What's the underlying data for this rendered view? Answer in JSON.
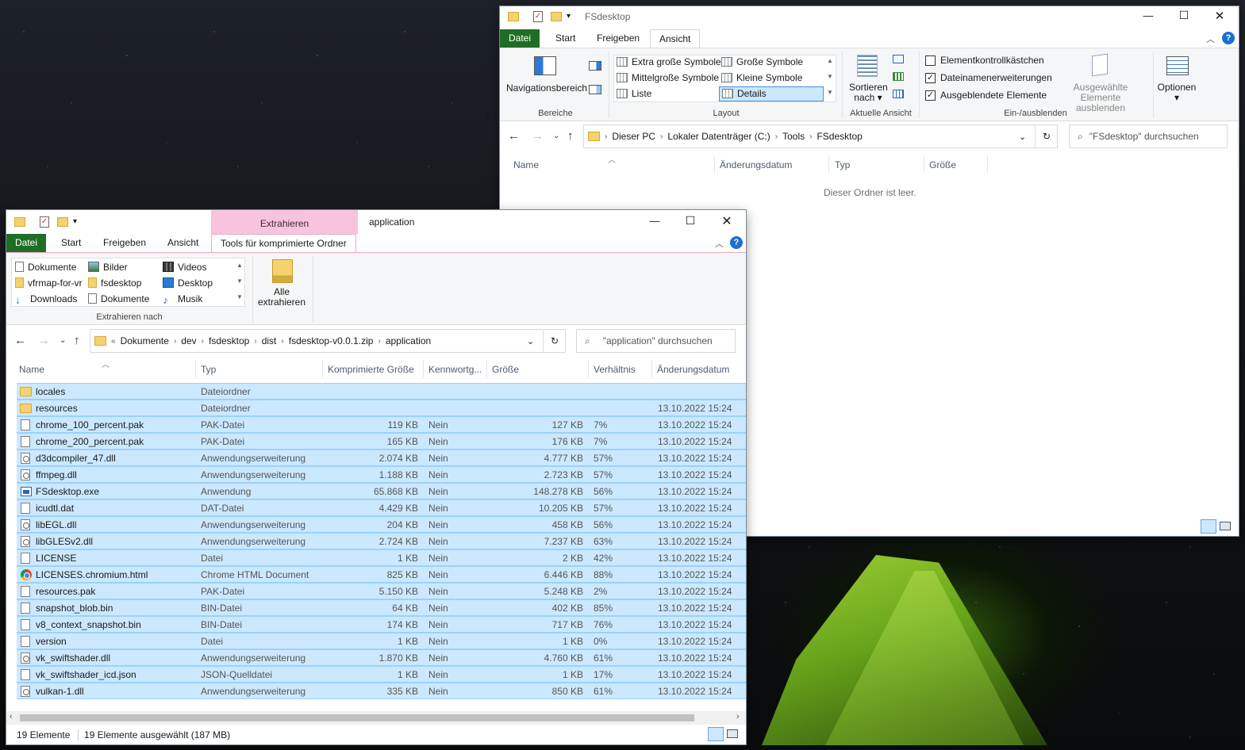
{
  "back_window": {
    "title": "FSdesktop",
    "tabs": [
      "Datei",
      "Start",
      "Freigeben",
      "Ansicht"
    ],
    "ribbon": {
      "bereiche": {
        "nav_pane": "Navigationsbereich",
        "label": "Bereiche"
      },
      "layout": {
        "items": [
          "Extra große Symbole",
          "Große Symbole",
          "Mittelgroße Symbole",
          "Kleine Symbole",
          "Liste",
          "Details"
        ],
        "selected": "Details",
        "label": "Layout"
      },
      "current_view": {
        "sort_line1": "Sortieren",
        "sort_line2": "nach",
        "label": "Aktuelle Ansicht"
      },
      "show_hide": {
        "checkboxes": [
          {
            "label": "Elementkontrollkästchen",
            "checked": false
          },
          {
            "label": "Dateinamenerweiterungen",
            "checked": true
          },
          {
            "label": "Ausgeblendete Elemente",
            "checked": true
          }
        ],
        "hide_selected_line1": "Ausgewählte",
        "hide_selected_line2": "Elemente ausblenden",
        "label": "Ein-/ausblenden"
      },
      "options": {
        "label": "Optionen"
      }
    },
    "address": [
      "Dieser PC",
      "Lokaler Datenträger (C:)",
      "Tools",
      "FSdesktop"
    ],
    "search_placeholder": "\"FSdesktop\" durchsuchen",
    "columns": [
      "Name",
      "Änderungsdatum",
      "Typ",
      "Größe"
    ],
    "empty_message": "Dieser Ordner ist leer."
  },
  "front_window": {
    "title": "application",
    "context_tab": "Extrahieren",
    "tabs": [
      "Datei",
      "Start",
      "Freigeben",
      "Ansicht",
      "Tools für komprimierte Ordner"
    ],
    "ribbon": {
      "quick_access": [
        [
          "Dokumente",
          "Bilder",
          "Videos"
        ],
        [
          "vfrmap-for-vr",
          "fsdesktop",
          "Desktop"
        ],
        [
          "Downloads",
          "Dokumente",
          "Musik"
        ]
      ],
      "extract_to_label": "Extrahieren nach",
      "extract_all_line1": "Alle",
      "extract_all_line2": "extrahieren"
    },
    "address_prefix": "«",
    "address": [
      "Dokumente",
      "dev",
      "fsdesktop",
      "dist",
      "fsdesktop-v0.0.1.zip",
      "application"
    ],
    "search_placeholder": "\"application\" durchsuchen",
    "columns": [
      "Name",
      "Typ",
      "Komprimierte Größe",
      "Kennwortg...",
      "Größe",
      "Verhältnis",
      "Änderungsdatum"
    ],
    "files": [
      {
        "icon": "folder",
        "name": "locales",
        "type": "Dateiordner",
        "compressed": "",
        "protected": "",
        "size": "",
        "ratio": "",
        "date": ""
      },
      {
        "icon": "folder",
        "name": "resources",
        "type": "Dateiordner",
        "compressed": "",
        "protected": "",
        "size": "",
        "ratio": "",
        "date": "13.10.2022 15:24"
      },
      {
        "icon": "file",
        "name": "chrome_100_percent.pak",
        "type": "PAK-Datei",
        "compressed": "119 KB",
        "protected": "Nein",
        "size": "127 KB",
        "ratio": "7%",
        "date": "13.10.2022 15:24"
      },
      {
        "icon": "file",
        "name": "chrome_200_percent.pak",
        "type": "PAK-Datei",
        "compressed": "165 KB",
        "protected": "Nein",
        "size": "176 KB",
        "ratio": "7%",
        "date": "13.10.2022 15:24"
      },
      {
        "icon": "gear",
        "name": "d3dcompiler_47.dll",
        "type": "Anwendungserweiterung",
        "compressed": "2.074 KB",
        "protected": "Nein",
        "size": "4.777 KB",
        "ratio": "57%",
        "date": "13.10.2022 15:24"
      },
      {
        "icon": "gear",
        "name": "ffmpeg.dll",
        "type": "Anwendungserweiterung",
        "compressed": "1.188 KB",
        "protected": "Nein",
        "size": "2.723 KB",
        "ratio": "57%",
        "date": "13.10.2022 15:24"
      },
      {
        "icon": "exe",
        "name": "FSdesktop.exe",
        "type": "Anwendung",
        "compressed": "65.868 KB",
        "protected": "Nein",
        "size": "148.278 KB",
        "ratio": "56%",
        "date": "13.10.2022 15:24"
      },
      {
        "icon": "file",
        "name": "icudtl.dat",
        "type": "DAT-Datei",
        "compressed": "4.429 KB",
        "protected": "Nein",
        "size": "10.205 KB",
        "ratio": "57%",
        "date": "13.10.2022 15:24"
      },
      {
        "icon": "gear",
        "name": "libEGL.dll",
        "type": "Anwendungserweiterung",
        "compressed": "204 KB",
        "protected": "Nein",
        "size": "458 KB",
        "ratio": "56%",
        "date": "13.10.2022 15:24"
      },
      {
        "icon": "gear",
        "name": "libGLESv2.dll",
        "type": "Anwendungserweiterung",
        "compressed": "2.724 KB",
        "protected": "Nein",
        "size": "7.237 KB",
        "ratio": "63%",
        "date": "13.10.2022 15:24"
      },
      {
        "icon": "file",
        "name": "LICENSE",
        "type": "Datei",
        "compressed": "1 KB",
        "protected": "Nein",
        "size": "2 KB",
        "ratio": "42%",
        "date": "13.10.2022 15:24"
      },
      {
        "icon": "chrome",
        "name": "LICENSES.chromium.html",
        "type": "Chrome HTML Document",
        "compressed": "825 KB",
        "protected": "Nein",
        "size": "6.446 KB",
        "ratio": "88%",
        "date": "13.10.2022 15:24"
      },
      {
        "icon": "file",
        "name": "resources.pak",
        "type": "PAK-Datei",
        "compressed": "5.150 KB",
        "protected": "Nein",
        "size": "5.248 KB",
        "ratio": "2%",
        "date": "13.10.2022 15:24"
      },
      {
        "icon": "file",
        "name": "snapshot_blob.bin",
        "type": "BIN-Datei",
        "compressed": "64 KB",
        "protected": "Nein",
        "size": "402 KB",
        "ratio": "85%",
        "date": "13.10.2022 15:24"
      },
      {
        "icon": "file",
        "name": "v8_context_snapshot.bin",
        "type": "BIN-Datei",
        "compressed": "174 KB",
        "protected": "Nein",
        "size": "717 KB",
        "ratio": "76%",
        "date": "13.10.2022 15:24"
      },
      {
        "icon": "file",
        "name": "version",
        "type": "Datei",
        "compressed": "1 KB",
        "protected": "Nein",
        "size": "1 KB",
        "ratio": "0%",
        "date": "13.10.2022 15:24"
      },
      {
        "icon": "gear",
        "name": "vk_swiftshader.dll",
        "type": "Anwendungserweiterung",
        "compressed": "1.870 KB",
        "protected": "Nein",
        "size": "4.760 KB",
        "ratio": "61%",
        "date": "13.10.2022 15:24"
      },
      {
        "icon": "file",
        "name": "vk_swiftshader_icd.json",
        "type": "JSON-Quelldatei",
        "compressed": "1 KB",
        "protected": "Nein",
        "size": "1 KB",
        "ratio": "17%",
        "date": "13.10.2022 15:24"
      },
      {
        "icon": "gear",
        "name": "vulkan-1.dll",
        "type": "Anwendungserweiterung",
        "compressed": "335 KB",
        "protected": "Nein",
        "size": "850 KB",
        "ratio": "61%",
        "date": "13.10.2022 15:24"
      }
    ],
    "status": {
      "count": "19 Elemente",
      "selected": "19 Elemente ausgewählt (187 MB)"
    }
  },
  "colors": {
    "datei_tab": "#1f6e26",
    "selection": "#cce8ff",
    "selection_border": "#99d1ff",
    "context_tab": "#f8c3dc",
    "help": "#1a6fd1"
  }
}
